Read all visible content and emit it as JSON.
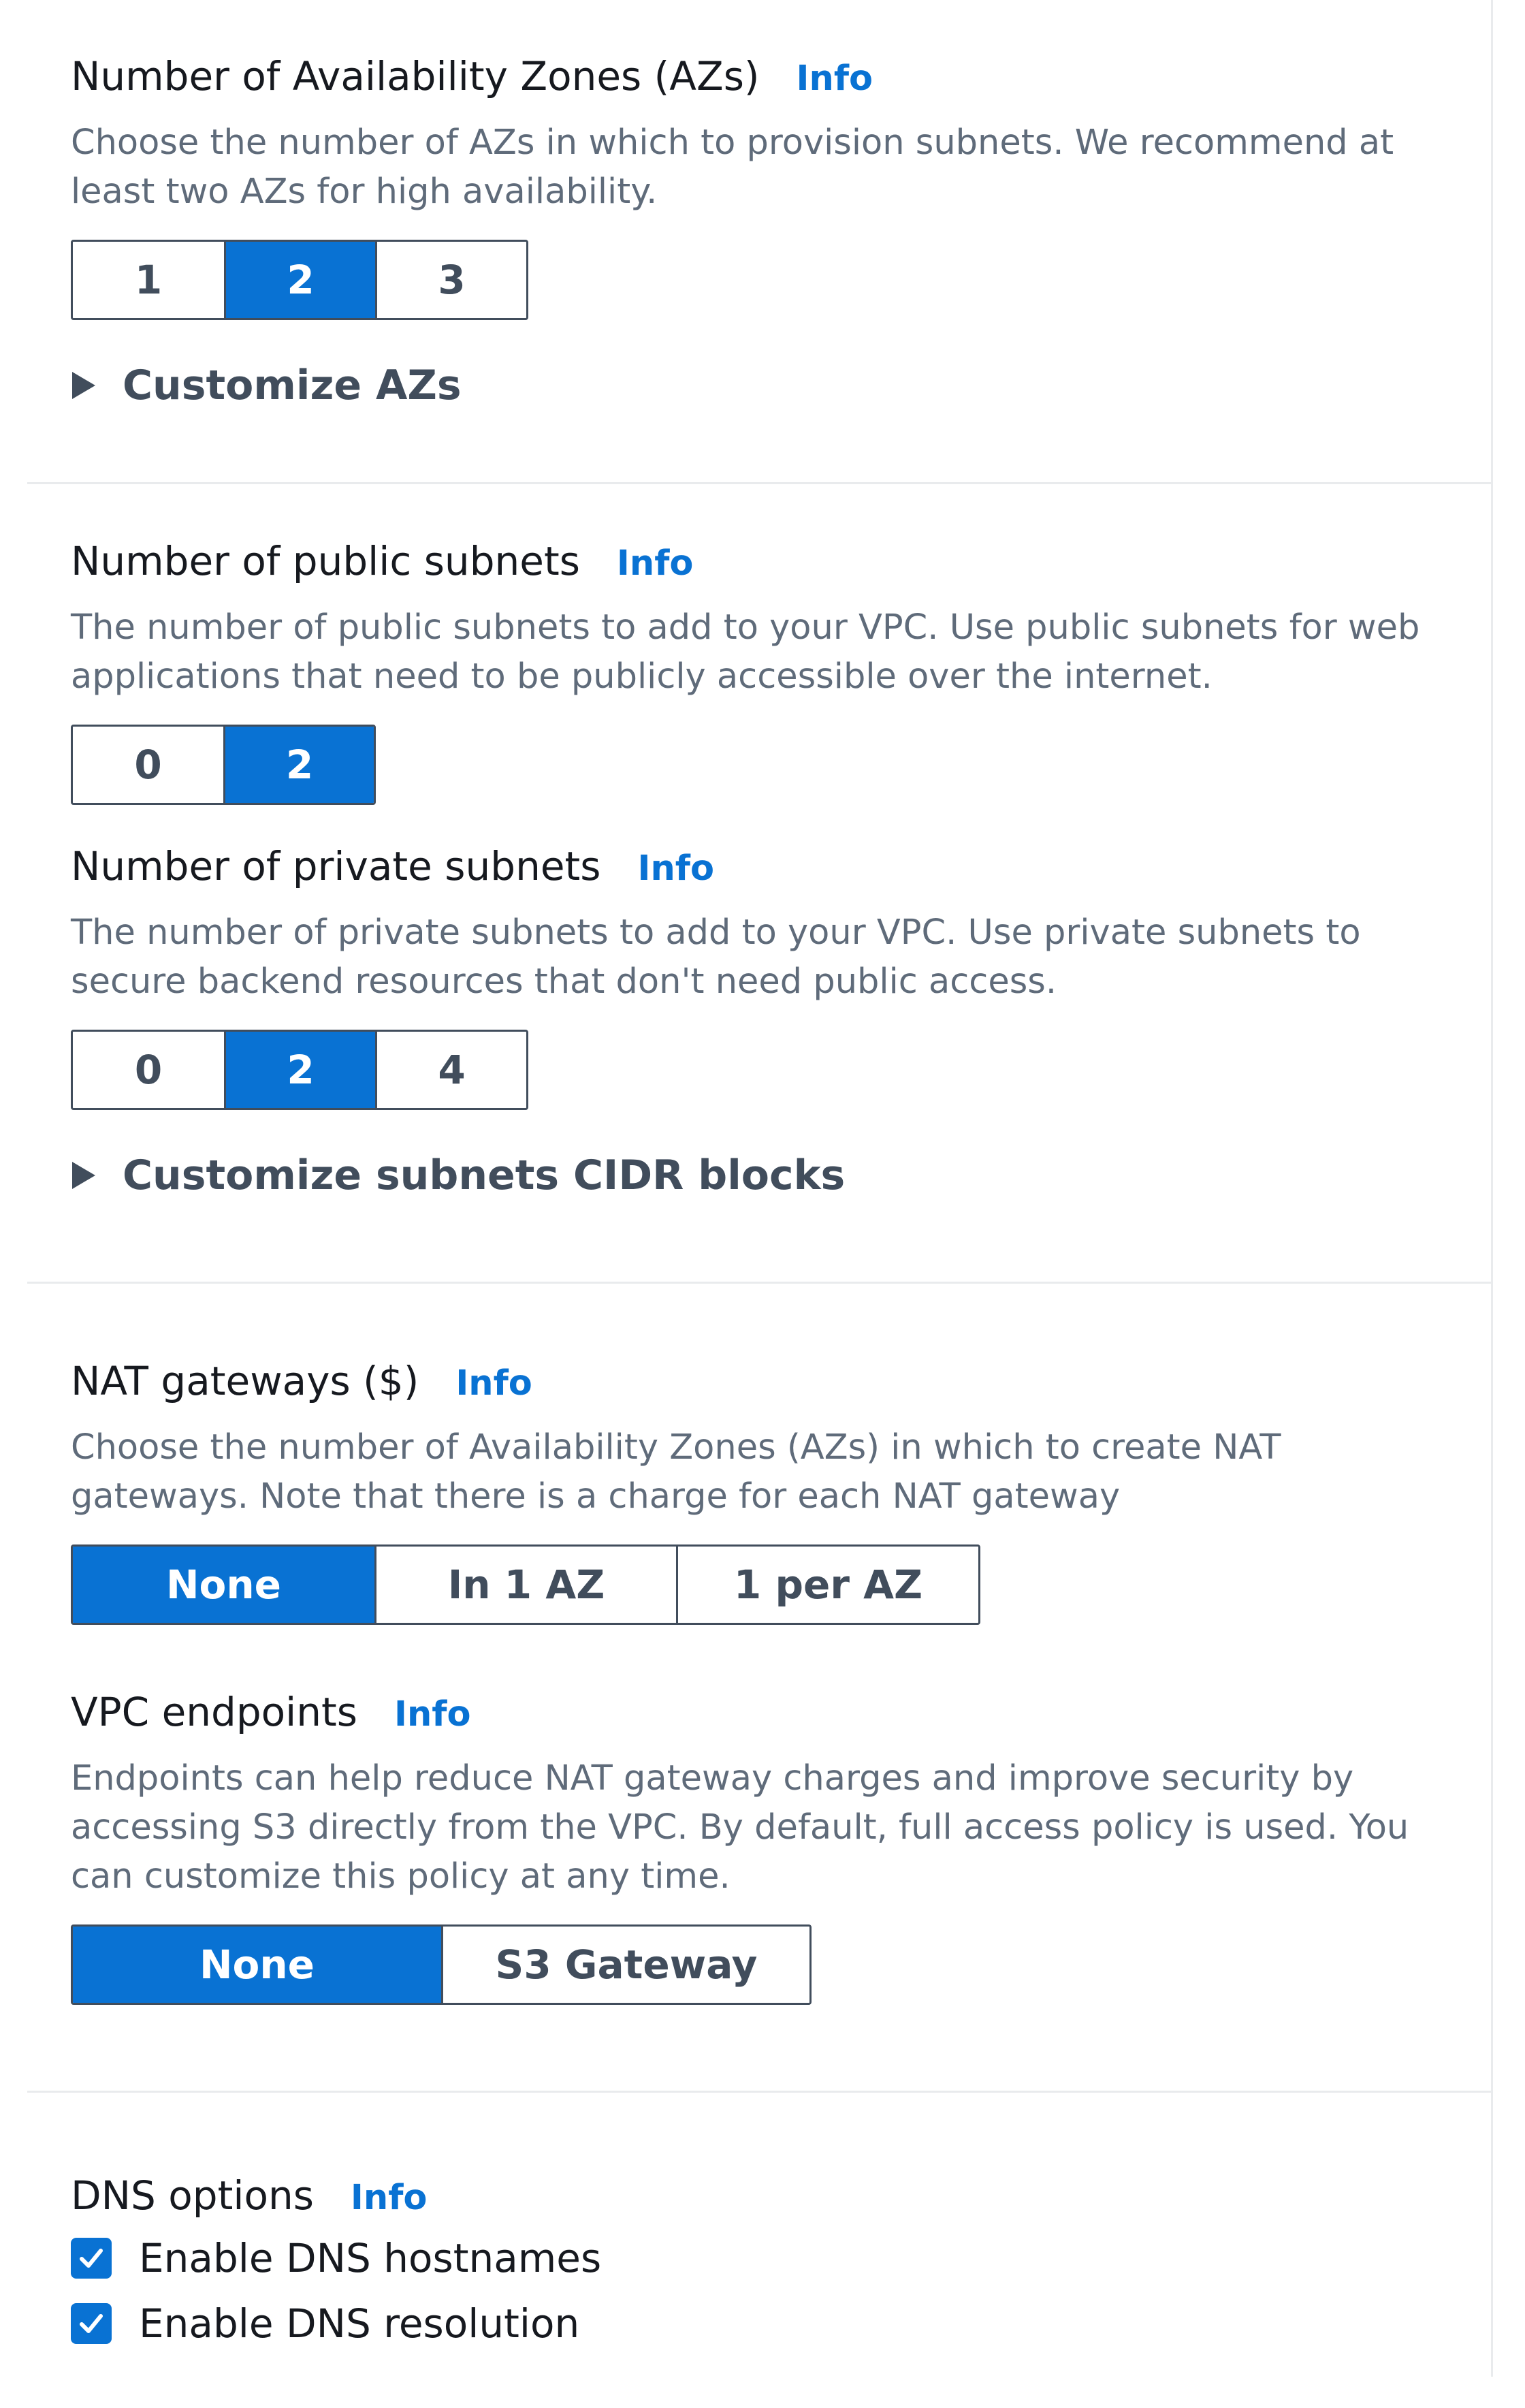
{
  "az": {
    "label": "Number of Availability Zones (AZs)",
    "info": "Info",
    "description": "Choose the number of AZs in which to provision subnets. We recommend at least two AZs for high availability.",
    "options": [
      "1",
      "2",
      "3"
    ],
    "selected": "2",
    "customize_label": "Customize AZs"
  },
  "public_subnets": {
    "label": "Number of public subnets",
    "info": "Info",
    "description": "The number of public subnets to add to your VPC. Use public subnets for web applications that need to be publicly accessible over the internet.",
    "options": [
      "0",
      "2"
    ],
    "selected": "2"
  },
  "private_subnets": {
    "label": "Number of private subnets",
    "info": "Info",
    "description": "The number of private subnets to add to your VPC. Use private subnets to secure backend resources that don't need public access.",
    "options": [
      "0",
      "2",
      "4"
    ],
    "selected": "2",
    "customize_label": "Customize subnets CIDR blocks"
  },
  "nat": {
    "label": "NAT gateways ($)",
    "info": "Info",
    "description": "Choose the number of Availability Zones (AZs) in which to create NAT gateways. Note that there is a charge for each NAT gateway",
    "options": [
      "None",
      "In 1 AZ",
      "1 per AZ"
    ],
    "selected": "None"
  },
  "endpoints": {
    "label": "VPC endpoints",
    "info": "Info",
    "description": "Endpoints can help reduce NAT gateway charges and improve security by accessing S3 directly from the VPC. By default, full access policy is used. You can customize this policy at any time.",
    "options": [
      "None",
      "S3 Gateway"
    ],
    "selected": "None"
  },
  "dns": {
    "label": "DNS options",
    "info": "Info",
    "options": [
      {
        "label": "Enable DNS hostnames",
        "checked": true
      },
      {
        "label": "Enable DNS resolution",
        "checked": true
      }
    ]
  },
  "colors": {
    "accent": "#0972d3",
    "text": "#16191f",
    "secondary_text": "#5f6b7a",
    "border": "#414d5c",
    "divider": "#e9ebed"
  },
  "icons": {
    "expander": "caret-right-icon",
    "checkbox": "check-icon"
  }
}
